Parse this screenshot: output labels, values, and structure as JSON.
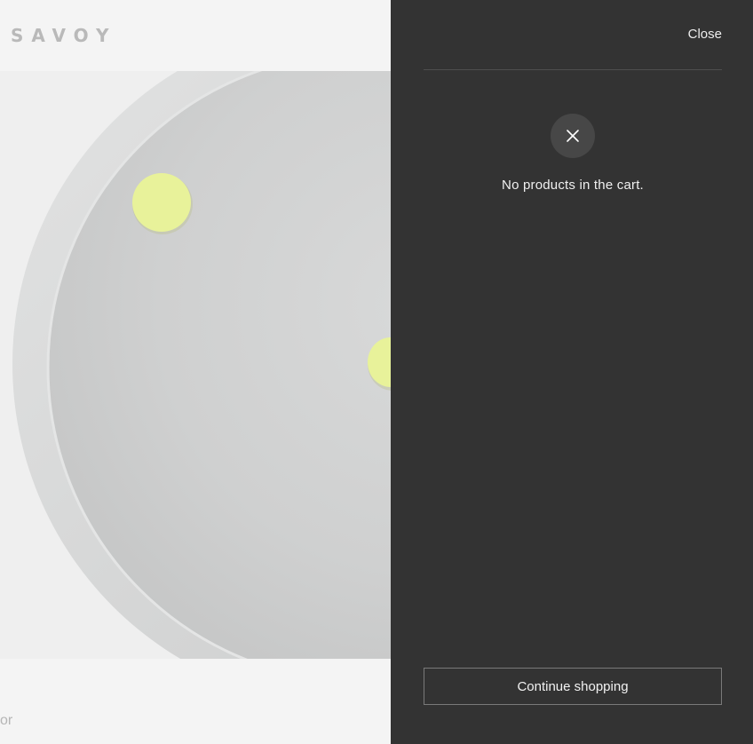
{
  "site": {
    "logo_text": "SAVOY",
    "footer_fragment": "or"
  },
  "cart": {
    "close_label": "Close",
    "empty_message": "No products in the cart.",
    "empty_icon": "close-icon",
    "continue_label": "Continue shopping"
  },
  "colors": {
    "drawer_background": "#333333",
    "page_background": "#f4f4f4",
    "accent_dot": "#e8f29a"
  }
}
